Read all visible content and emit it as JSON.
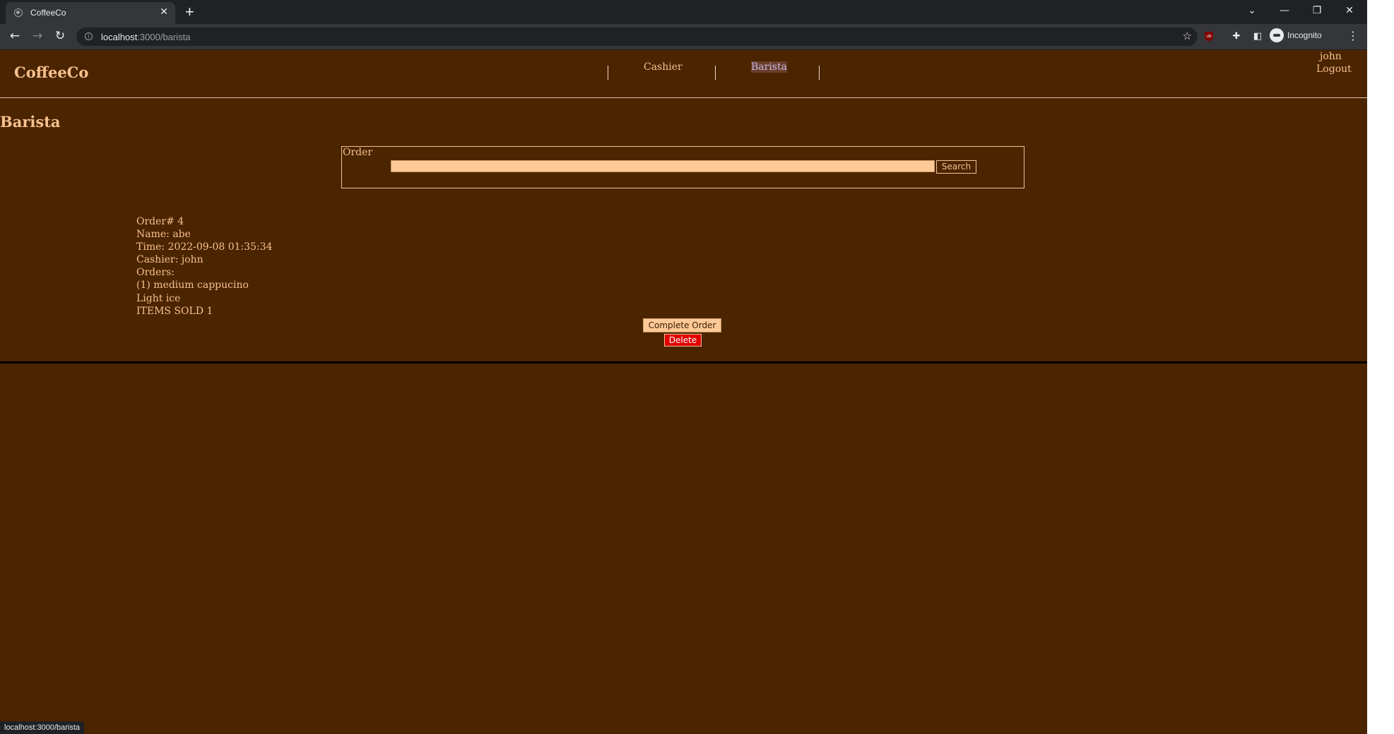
{
  "browser": {
    "tab_title": "CoffeeCo",
    "tab_close": "✕",
    "new_tab": "+",
    "url_host": "localhost",
    "url_path": ":3000/barista",
    "incognito_label": "Incognito",
    "status_url": "localhost:3000/barista",
    "window_controls": {
      "tab_search": "⌄",
      "minimize": "—",
      "restore": "❐",
      "close": "✕"
    },
    "icons": [
      "back-arrow-icon",
      "forward-arrow-icon",
      "reload-icon",
      "info-icon",
      "star-icon",
      "ublock-icon",
      "extensions-puzzle-icon",
      "side-panel-icon",
      "incognito-icon",
      "kebab-menu-icon"
    ]
  },
  "site": {
    "brand": "CoffeeCo",
    "nav": [
      {
        "label": "Cashier",
        "active": false
      },
      {
        "label": "Barista",
        "active": true
      }
    ],
    "user": {
      "name": "john",
      "logout": "Logout"
    }
  },
  "page": {
    "title": "Barista",
    "search": {
      "legend": "Order",
      "value": "",
      "button": "Search"
    },
    "order": {
      "number_line": "Order# 4",
      "name_line": "Name: abe",
      "time_line": "Time: 2022-09-08 01:35:34",
      "cashier_line": "Cashier: john",
      "orders_label": "Orders:",
      "items": [
        "(1) medium cappucino",
        "Light ice"
      ],
      "items_sold_line": "ITEMS SOLD 1"
    },
    "actions": {
      "complete": "Complete Order",
      "delete": "Delete"
    }
  },
  "colors": {
    "page_bg": "#4b2400",
    "text": "#f6c28f",
    "input_bg": "#fdc997",
    "delete_bg": "#e00000"
  }
}
